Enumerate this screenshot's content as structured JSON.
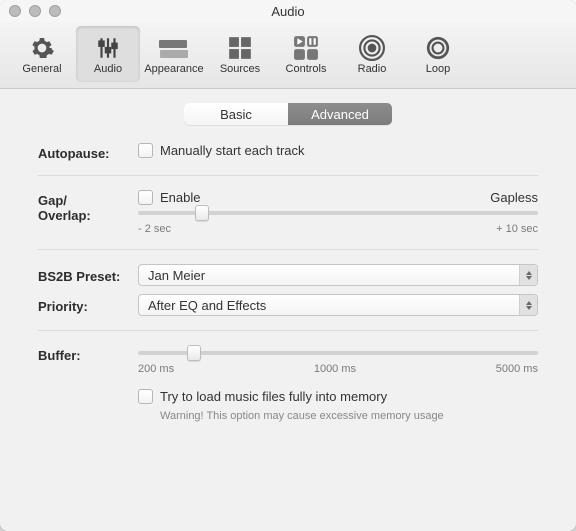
{
  "window": {
    "title": "Audio"
  },
  "toolbar": {
    "items": [
      {
        "label": "General"
      },
      {
        "label": "Audio"
      },
      {
        "label": "Appearance"
      },
      {
        "label": "Sources"
      },
      {
        "label": "Controls"
      },
      {
        "label": "Radio"
      },
      {
        "label": "Loop"
      }
    ],
    "selected": "Audio"
  },
  "tabs": {
    "basic": "Basic",
    "advanced": "Advanced",
    "active": "advanced"
  },
  "autopause": {
    "label": "Autopause:",
    "checkbox": "Manually start each track"
  },
  "gap": {
    "label": "Gap/\nOverlap:",
    "enable": "Enable",
    "gapless": "Gapless",
    "min": "- 2 sec",
    "max": "+ 10 sec",
    "thumb_percent": 16
  },
  "bs2b": {
    "label": "BS2B Preset:",
    "value": "Jan Meier"
  },
  "priority": {
    "label": "Priority:",
    "value": "After EQ and Effects"
  },
  "buffer": {
    "label": "Buffer:",
    "t1": "200 ms",
    "t2": "1000 ms",
    "t3": "5000 ms",
    "thumb_percent": 14,
    "checkbox": "Try to load music files fully into memory",
    "warning": "Warning! This option may cause excessive memory usage"
  }
}
